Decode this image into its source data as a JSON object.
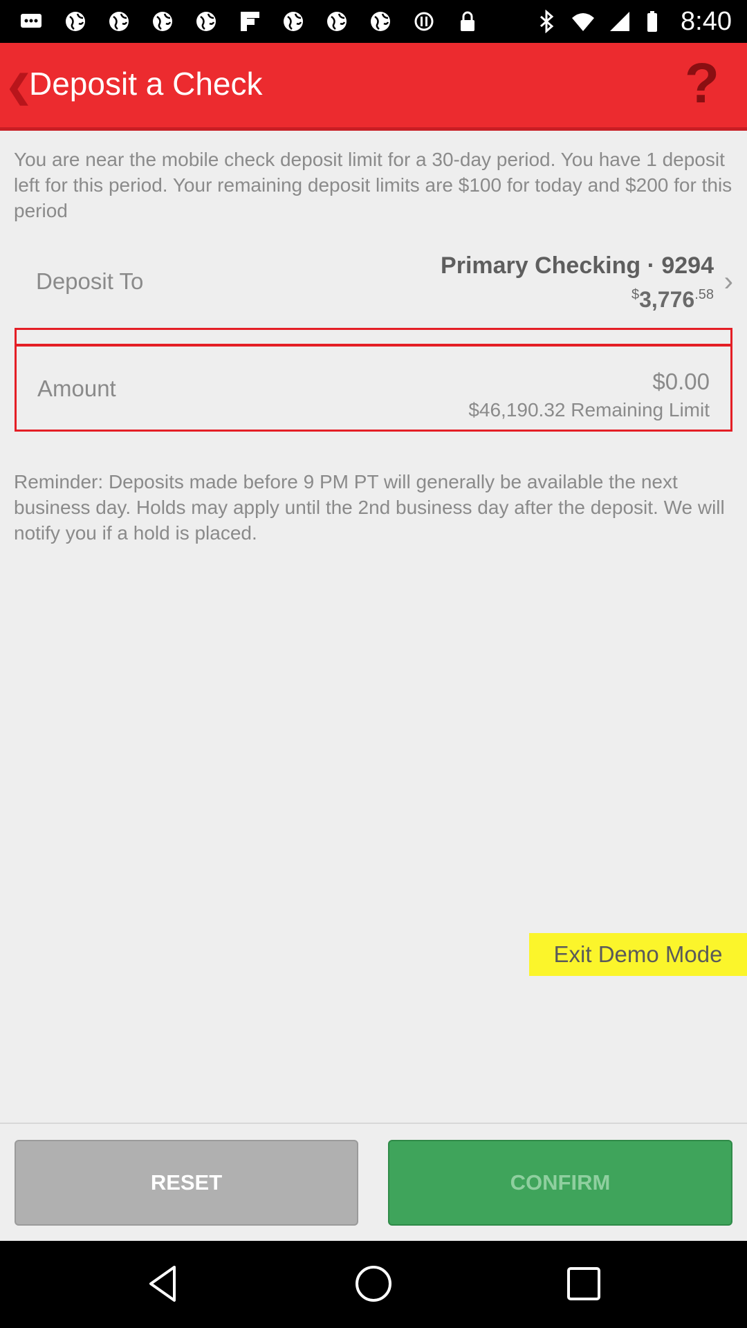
{
  "status_bar": {
    "time": "8:40",
    "left_icons": [
      "message-icon",
      "globe-icon",
      "globe-icon",
      "globe-icon",
      "flipboard-icon",
      "globe-icon",
      "globe-icon",
      "globe-icon",
      "sync-icon",
      "lock-icon"
    ],
    "right_icons": [
      "bluetooth-icon",
      "wifi-icon",
      "signal-icon",
      "battery-icon"
    ]
  },
  "header": {
    "back_icon": "chevron-left-icon",
    "title": "Deposit a Check",
    "help_label": "?"
  },
  "notice": "You are near the mobile check deposit limit for a 30-day period. You have 1 deposit left for this period. Your remaining deposit limits are $100 for today and $200 for this period",
  "deposit_to": {
    "label": "Deposit To",
    "account": "Primary Checking · 9294",
    "balance_currency": "$",
    "balance_main": "3,776",
    "balance_cents": ".58",
    "chevron": "›"
  },
  "amount": {
    "label": "Amount",
    "value": "$0.00",
    "remaining_limit": "$46,190.32 Remaining Limit"
  },
  "reminder": "Reminder: Deposits made before 9 PM PT will generally be available the next business day. Holds may apply until the 2nd business day after the deposit. We will notify you if a hold is placed.",
  "demo": {
    "exit_label": "Exit Demo Mode"
  },
  "actions": {
    "reset_label": "RESET",
    "confirm_label": "CONFIRM"
  },
  "colors": {
    "brand_red": "#ec2b2f",
    "confirm_green": "#3fa45b",
    "demo_yellow": "#fbf52b"
  }
}
